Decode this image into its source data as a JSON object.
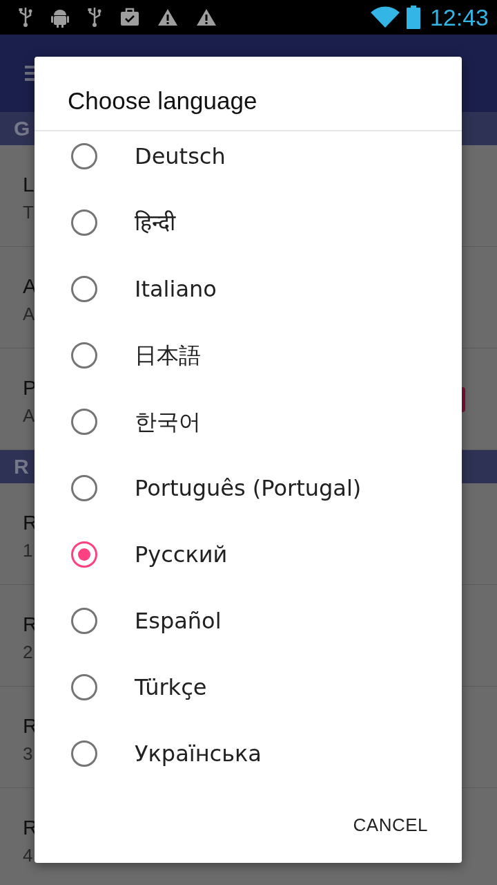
{
  "status_bar": {
    "left_icons": [
      {
        "kind": "usb"
      },
      {
        "kind": "android"
      },
      {
        "kind": "usb"
      },
      {
        "kind": "briefcase"
      },
      {
        "kind": "warning"
      },
      {
        "kind": "warning"
      }
    ],
    "time": "12:43"
  },
  "settings": {
    "sections": [
      {
        "header": "G",
        "rows": [
          {
            "title": "L",
            "summary": "T"
          },
          {
            "title": "A",
            "summary": "A"
          },
          {
            "title": "P",
            "summary": "A",
            "switch": true
          }
        ]
      },
      {
        "header": "R",
        "rows": [
          {
            "title": "R",
            "summary": "1"
          },
          {
            "title": "R",
            "summary": "2"
          },
          {
            "title": "R",
            "summary": "3"
          },
          {
            "title": "R",
            "summary": "4"
          }
        ]
      }
    ]
  },
  "dialog": {
    "title": "Choose language",
    "options": [
      {
        "label": "Deutsch",
        "selected": false
      },
      {
        "label": "हिन्दी",
        "selected": false
      },
      {
        "label": "Italiano",
        "selected": false
      },
      {
        "label": "日本語",
        "selected": false
      },
      {
        "label": "한국어",
        "selected": false
      },
      {
        "label": "Português (Portugal)",
        "selected": false
      },
      {
        "label": "Русский",
        "selected": true
      },
      {
        "label": "Español",
        "selected": false
      },
      {
        "label": "Türkçe",
        "selected": false
      },
      {
        "label": "Українська",
        "selected": false
      }
    ],
    "buttons": [
      "CANCEL"
    ]
  }
}
